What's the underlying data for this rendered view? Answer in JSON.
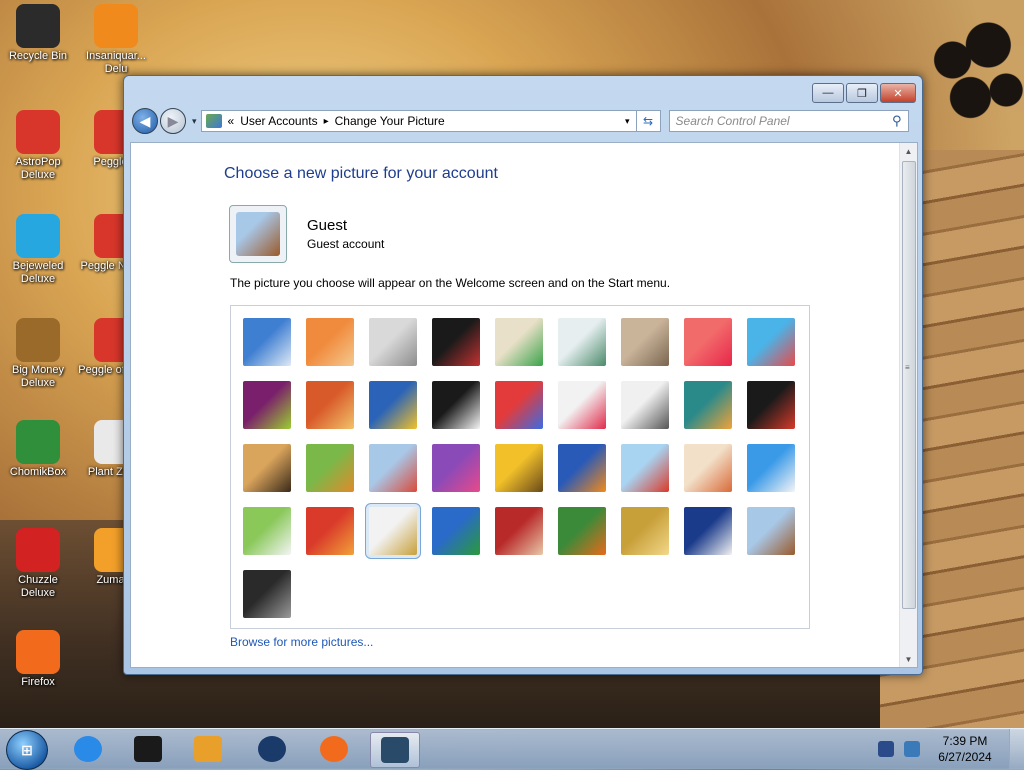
{
  "desktop": {
    "icons": [
      {
        "label": "Recycle Bin",
        "glyph": "recycle-bin-icon",
        "color": "#2b2b2b"
      },
      {
        "label": "Insaniquar... Delu",
        "glyph": "goldfish-icon",
        "color": "#f08a1c"
      },
      {
        "label": "AstroPop Deluxe",
        "glyph": "astropop-icon",
        "color": "#d8362b"
      },
      {
        "label": "Peggle D",
        "glyph": "peggle-icon",
        "color": "#d8362b"
      },
      {
        "label": "Bejeweled Deluxe",
        "glyph": "gem-icon",
        "color": "#27a7e0"
      },
      {
        "label": "Peggle N Delu",
        "glyph": "peggle-icon",
        "color": "#d8362b"
      },
      {
        "label": "Big Money Deluxe",
        "glyph": "money-bag-icon",
        "color": "#9a6a2a"
      },
      {
        "label": "Peggle of Ward",
        "glyph": "peggle-icon",
        "color": "#d8362b"
      },
      {
        "label": "ChomikBox",
        "glyph": "hamster-icon",
        "color": "#2f8f3a"
      },
      {
        "label": "Plant Zomb",
        "glyph": "flower-icon",
        "color": "#e9e9e9"
      },
      {
        "label": "Chuzzle Deluxe",
        "glyph": "chuzzle-icon",
        "color": "#d32222"
      },
      {
        "label": "Zuma D",
        "glyph": "zuma-icon",
        "color": "#f2a02a"
      },
      {
        "label": "Firefox",
        "glyph": "firefox-icon",
        "color": "#f26b1d"
      }
    ]
  },
  "window": {
    "controls": {
      "minimize": "—",
      "maximize": "❐",
      "close": "✕"
    },
    "nav": {
      "back": "◀",
      "forward": "▶",
      "history_dropdown": "▾"
    },
    "address": {
      "prefix": "«",
      "crumbs": [
        "User Accounts",
        "Change Your Picture"
      ],
      "separator": "▸",
      "dropdown": "▾",
      "refresh": "⇆"
    },
    "search": {
      "placeholder": "Search Control Panel",
      "icon": "⚲"
    }
  },
  "page": {
    "heading": "Choose a new picture for your account",
    "user_name": "Guest",
    "user_type": "Guest account",
    "description": "The picture you choose will appear on the Welcome screen and on the Start menu.",
    "browse_link": "Browse for more pictures...",
    "pictures": [
      {
        "name": "ferris-wheel-picture",
        "colors": [
          "#3f7fd1",
          "#dfe9f5"
        ]
      },
      {
        "name": "starfish-picture",
        "colors": [
          "#f08a3c",
          "#f5c98f"
        ]
      },
      {
        "name": "robot-dog-picture",
        "colors": [
          "#d9d9d9",
          "#8c8c8c"
        ]
      },
      {
        "name": "vinyl-record-picture",
        "colors": [
          "#1a1a1a",
          "#c43232"
        ]
      },
      {
        "name": "lucky-cat-picture",
        "colors": [
          "#e8e0c8",
          "#3aa34a"
        ]
      },
      {
        "name": "gyroscope-picture",
        "colors": [
          "#e6eef0",
          "#4a8a6a"
        ]
      },
      {
        "name": "kitten-picture",
        "colors": [
          "#c9b49a",
          "#7a6550"
        ]
      },
      {
        "name": "flower-picture",
        "colors": [
          "#f26b6b",
          "#e8264a"
        ]
      },
      {
        "name": "pinwheel-picture",
        "colors": [
          "#4ab4e8",
          "#e84a4a"
        ]
      },
      {
        "name": "ball-picture",
        "colors": [
          "#7a1f6b",
          "#9acd32"
        ]
      },
      {
        "name": "fabric-squares-picture",
        "colors": [
          "#d85a2a",
          "#f2c36a"
        ]
      },
      {
        "name": "leaf-picture",
        "colors": [
          "#2a63b8",
          "#f2c12a"
        ]
      },
      {
        "name": "dog-picture",
        "colors": [
          "#1a1a1a",
          "#f5f5f5"
        ]
      },
      {
        "name": "crayons-picture",
        "colors": [
          "#e33b3b",
          "#3b6be3"
        ]
      },
      {
        "name": "star-picture",
        "colors": [
          "#f2f2f2",
          "#e02a4a"
        ]
      },
      {
        "name": "jacks-picture",
        "colors": [
          "#f0f0f0",
          "#555555"
        ]
      },
      {
        "name": "stairs-picture",
        "colors": [
          "#2a8a8a",
          "#f2a23a"
        ]
      },
      {
        "name": "origami-crane-picture",
        "colors": [
          "#1a1a1a",
          "#d63a2a"
        ]
      },
      {
        "name": "guitar-picture",
        "colors": [
          "#d9a45c",
          "#3a2a1a"
        ]
      },
      {
        "name": "pomeranian-picture",
        "colors": [
          "#7ab84a",
          "#e08a2a"
        ]
      },
      {
        "name": "toy-robot-picture",
        "colors": [
          "#a8c8e8",
          "#d94a3a"
        ]
      },
      {
        "name": "scarf-picture",
        "colors": [
          "#8a4ab8",
          "#e84a8a"
        ]
      },
      {
        "name": "sunflower-picture",
        "colors": [
          "#f2c12a",
          "#6a4a1a"
        ]
      },
      {
        "name": "fish-picture",
        "colors": [
          "#2a5ab8",
          "#f28a1a"
        ]
      },
      {
        "name": "hot-air-balloon-picture",
        "colors": [
          "#a8d4f2",
          "#d93a2a"
        ]
      },
      {
        "name": "egg-doll-picture",
        "colors": [
          "#f2e0c8",
          "#d96a3a"
        ]
      },
      {
        "name": "sailboat-picture",
        "colors": [
          "#3a9ae8",
          "#f5f5f5"
        ]
      },
      {
        "name": "soccer-ball-picture",
        "colors": [
          "#8ac85a",
          "#f5f5f5"
        ]
      },
      {
        "name": "fabric-picture",
        "colors": [
          "#d93a2a",
          "#f2a23a"
        ]
      },
      {
        "name": "marbles-picture",
        "colors": [
          "#f2f2f2",
          "#c8a03a"
        ]
      },
      {
        "name": "window-frame-picture",
        "colors": [
          "#2a6ac8",
          "#2a9a3a"
        ]
      },
      {
        "name": "patterned-fabric-picture",
        "colors": [
          "#b82a2a",
          "#e8c8a8"
        ]
      },
      {
        "name": "butterfly-picture",
        "colors": [
          "#3a8a3a",
          "#e86a1a"
        ]
      },
      {
        "name": "spiral-picture",
        "colors": [
          "#c8a03a",
          "#f2d88a"
        ]
      },
      {
        "name": "lighthouse-picture",
        "colors": [
          "#1a3a8a",
          "#f2f2f2"
        ]
      },
      {
        "name": "suitcase-picture",
        "colors": [
          "#a8c8e8",
          "#9a5a2a"
        ]
      },
      {
        "name": "custom-picture",
        "colors": [
          "#2a2a2a",
          "#9a9a9a"
        ]
      }
    ],
    "selected_index": 29,
    "current_picture_colors": [
      "#a8c8e8",
      "#9a5a2a"
    ]
  },
  "taskbar": {
    "start_label": "⊞",
    "items": [
      {
        "name": "ie-icon",
        "color": "#2a8ae8"
      },
      {
        "name": "terminal-icon",
        "color": "#1a1a1a"
      },
      {
        "name": "media-player-icon",
        "color": "#e8a02a"
      },
      {
        "name": "globe-icon",
        "color": "#1a3a6a"
      },
      {
        "name": "firefox-icon",
        "color": "#f26b1d"
      },
      {
        "name": "control-panel-icon",
        "color": "#2a4a6a"
      }
    ],
    "time": "7:39 PM",
    "date": "6/27/2024"
  }
}
